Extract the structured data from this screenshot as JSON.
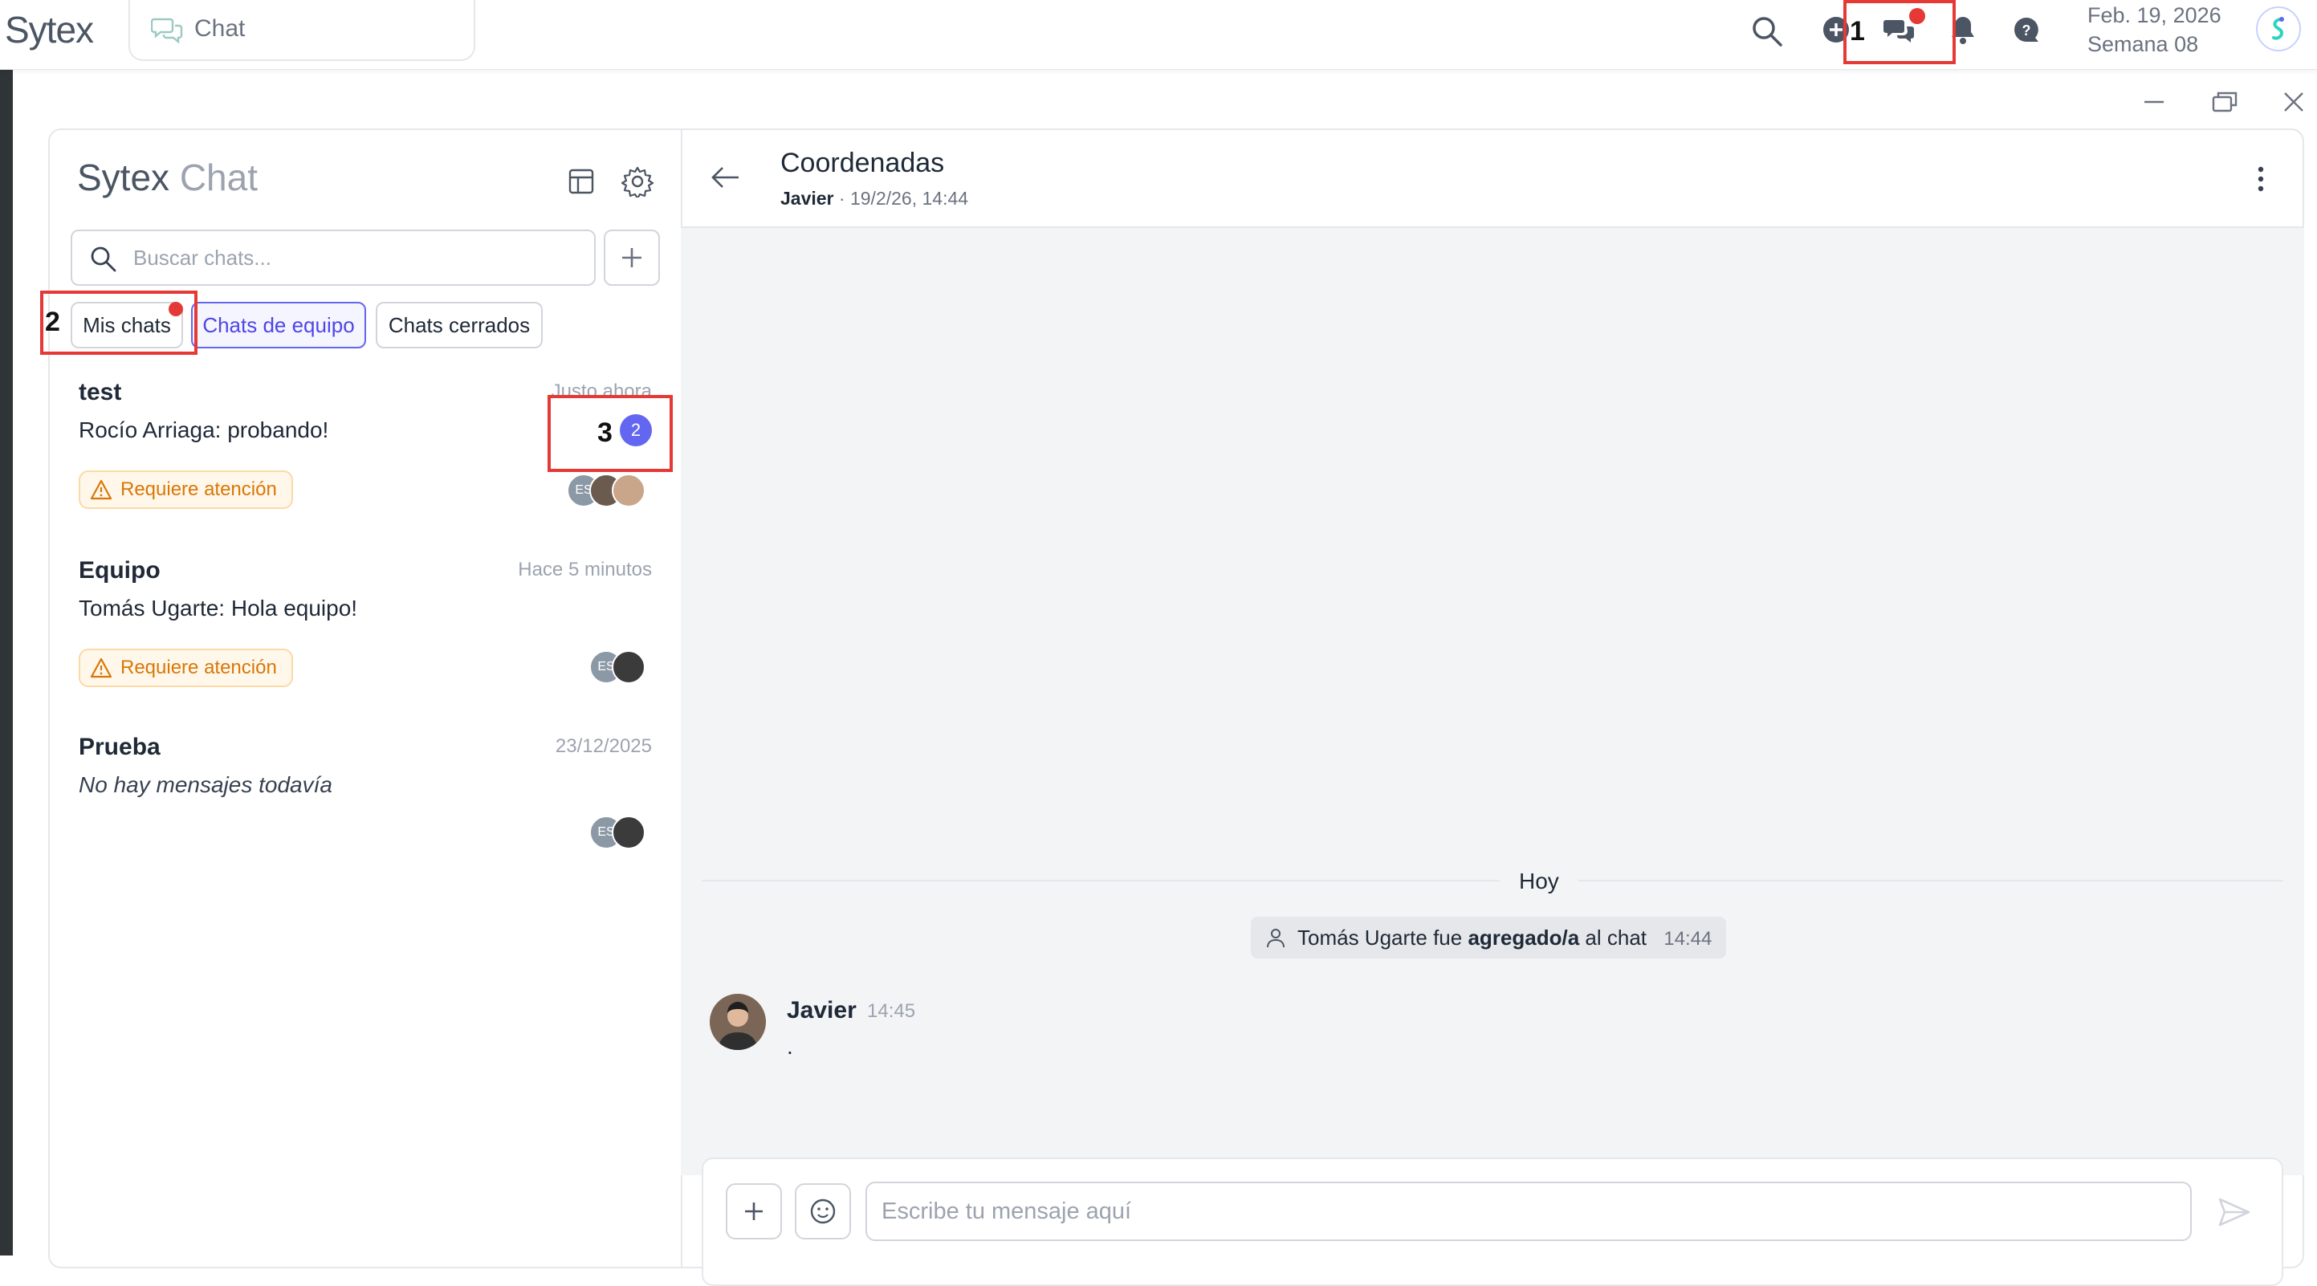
{
  "app": {
    "logo": "Sytex",
    "module_label": "Chat"
  },
  "header": {
    "date": "Feb. 19, 2026",
    "week": "Semana 08"
  },
  "annotations": {
    "one": "1",
    "two": "2",
    "three": "3"
  },
  "sidebar": {
    "title_a": "Sytex",
    "title_b": "Chat",
    "search_placeholder": "Buscar chats...",
    "tabs": [
      {
        "label": "Mis chats"
      },
      {
        "label": "Chats de equipo"
      },
      {
        "label": "Chats cerrados"
      }
    ],
    "chats": [
      {
        "name": "test",
        "time": "Justo ahora",
        "last_message": "Rocío Arriaga: probando!",
        "attention": "Requiere atención",
        "unread": "2",
        "avatar_initials": "ES"
      },
      {
        "name": "Equipo",
        "time": "Hace 5 minutos",
        "last_message": "Tomás Ugarte: Hola equipo!",
        "attention": "Requiere atención",
        "avatar_initials": "ES"
      },
      {
        "name": "Prueba",
        "time": "23/12/2025",
        "last_message": "No hay mensajes todavía",
        "avatar_initials": "ES"
      }
    ]
  },
  "conversation": {
    "title": "Coordenadas",
    "author": "Javier",
    "meta_separator": "·",
    "meta_time": "19/2/26, 14:44",
    "day_label": "Hoy",
    "system_message": {
      "pre": "Tomás Ugarte fue",
      "bold": "agregado/a",
      "post": "al chat",
      "time": "14:44"
    },
    "messages": [
      {
        "author": "Javier",
        "time": "14:45",
        "text": "."
      }
    ],
    "composer_placeholder": "Escribe tu mensaje aquí"
  },
  "colors": {
    "accent": "#6366f1",
    "alert": "#e53935",
    "warning": "#d97706"
  }
}
